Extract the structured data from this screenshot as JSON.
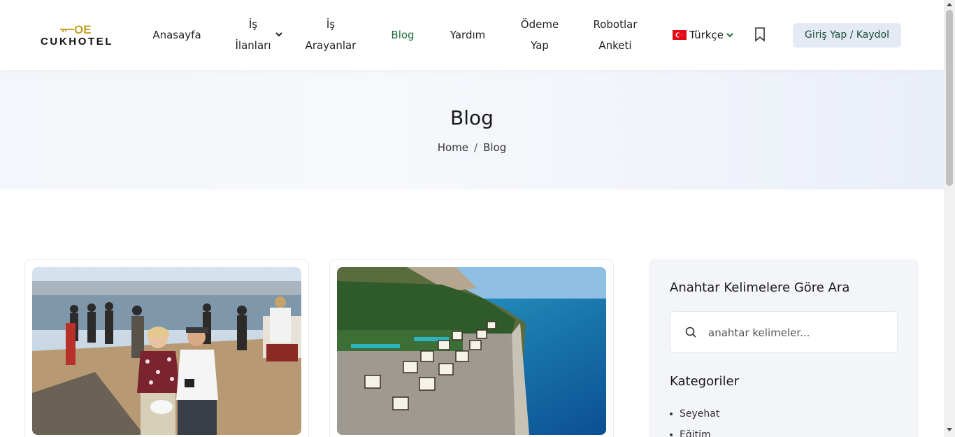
{
  "brand": {
    "name": "CUKHOTEL",
    "accent": "#c9a227"
  },
  "nav": {
    "anasayfa": "Anasayfa",
    "is_ilanlari": "İş İlanları",
    "is_arayanlar": "İş Arayanlar",
    "blog": "Blog",
    "yardim": "Yardım",
    "odeme_yap": "Ödeme Yap",
    "robotlar_anketi": "Robotlar Anketi",
    "active_color": "#1d6d3a"
  },
  "language": {
    "selected": "Türkçe",
    "flag_icon": "turkey-flag-icon"
  },
  "header_actions": {
    "bookmark_icon": "bookmark-icon",
    "login_label": "Giriş Yap / Kaydol"
  },
  "hero": {
    "title": "Blog",
    "breadcrumb": [
      "Home",
      "Blog"
    ],
    "separator": "/"
  },
  "posts": [
    {
      "image": "tourists-walking-on-pier-photo"
    },
    {
      "image": "beach-resort-aerial-photo"
    }
  ],
  "sidebar": {
    "search_title": "Anahtar Kelimelere Göre Ara",
    "search_placeholder": "anahtar kelimeler...",
    "categories_title": "Kategoriler",
    "categories": [
      "Seyehat",
      "Eğitim"
    ]
  }
}
